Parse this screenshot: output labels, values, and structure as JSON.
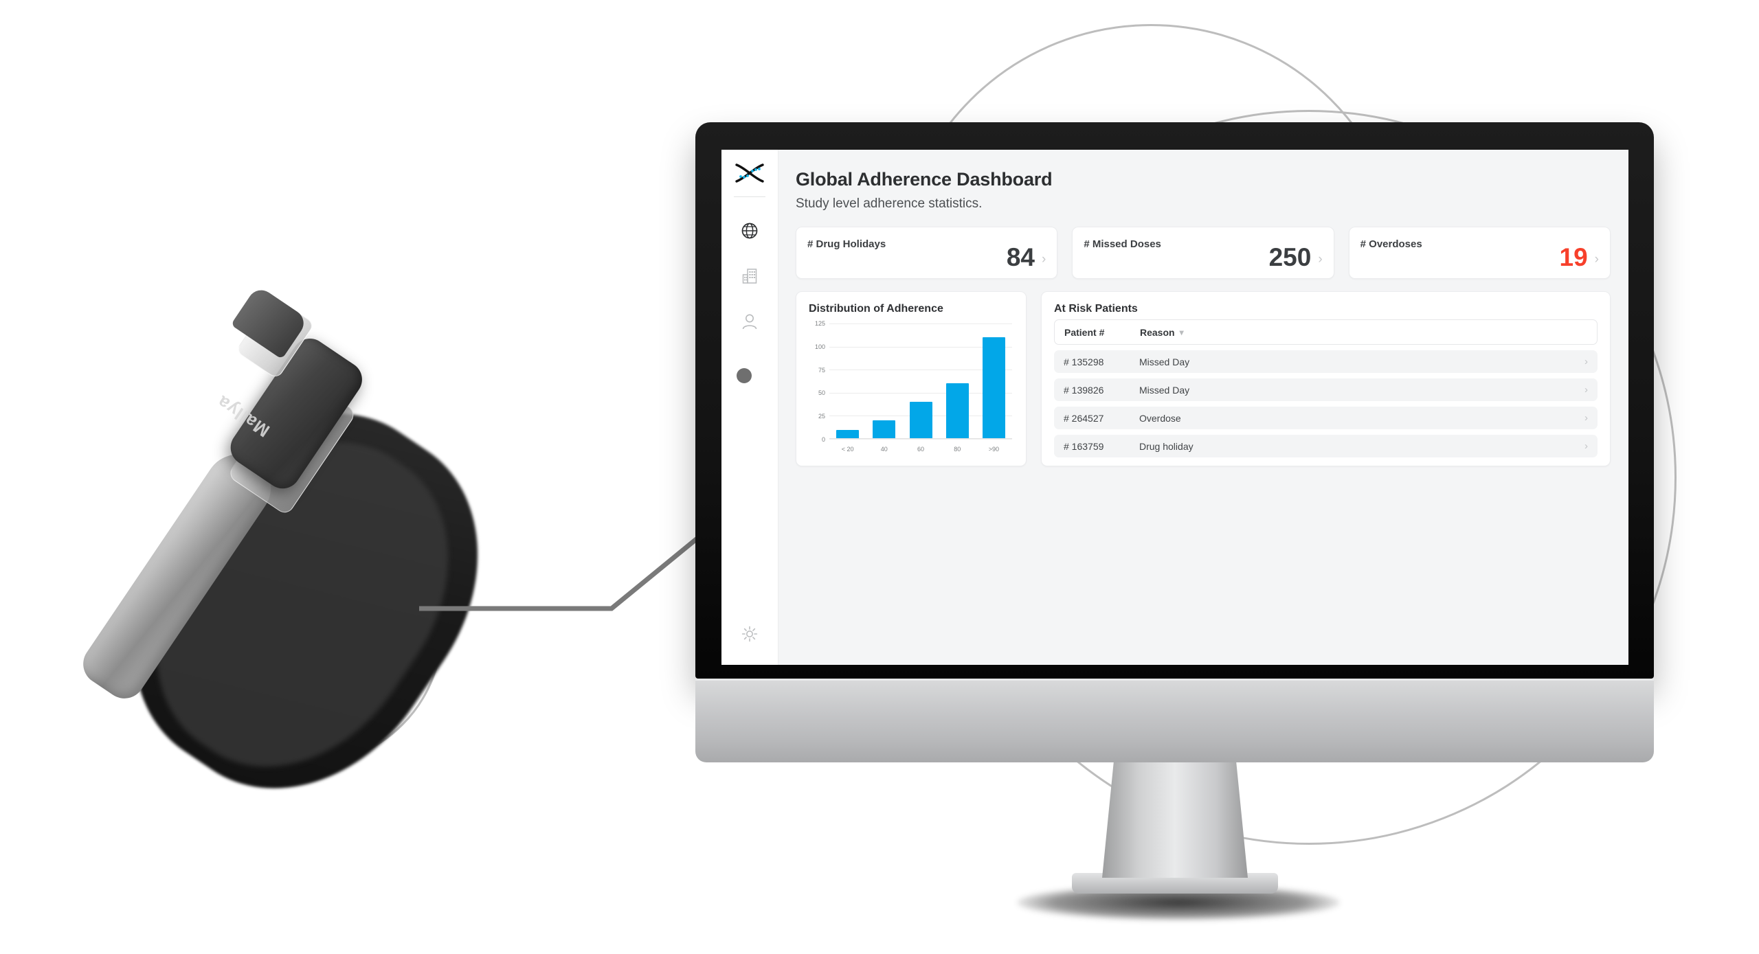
{
  "app": {
    "logo_name": "dna-helix-logo",
    "accent_blue": "#02a7e8",
    "danger_red": "#f7402b"
  },
  "sidebar": {
    "items": [
      {
        "icon": "globe-icon",
        "name": "sidebar-item-global",
        "active": true
      },
      {
        "icon": "building-icon",
        "name": "sidebar-item-sites",
        "active": false
      },
      {
        "icon": "person-icon",
        "name": "sidebar-item-patients",
        "active": false
      }
    ],
    "bottom": {
      "icon": "gear-icon",
      "name": "sidebar-item-settings"
    }
  },
  "header": {
    "title": "Global Adherence Dashboard",
    "subtitle": "Study level adherence statistics."
  },
  "stats": [
    {
      "label": "# Drug Holidays",
      "value": "84",
      "danger": false,
      "chevron": "›"
    },
    {
      "label": "# Missed Doses",
      "value": "250",
      "danger": false,
      "chevron": "›"
    },
    {
      "label": "# Overdoses",
      "value": "19",
      "danger": true,
      "chevron": "›"
    }
  ],
  "chart_panel": {
    "title": "Distribution of Adherence"
  },
  "chart_data": {
    "type": "bar",
    "title": "Distribution of Adherence",
    "categories": [
      "< 20",
      "40",
      "60",
      "80",
      ">90"
    ],
    "values": [
      10,
      20,
      40,
      60,
      110
    ],
    "yticks": [
      0,
      25,
      50,
      75,
      100,
      125
    ],
    "ylim": [
      0,
      125
    ],
    "xlabel": "",
    "ylabel": "",
    "grid": true,
    "legend": false,
    "series_color": "#02a7e8"
  },
  "risk_panel": {
    "title": "At Risk Patients",
    "columns": [
      "Patient #",
      "Reason"
    ],
    "sort_icon": "chevron-down-icon",
    "rows": [
      {
        "patient": "# 135298",
        "reason": "Missed Day",
        "chevron": "›"
      },
      {
        "patient": "# 139826",
        "reason": "Missed Day",
        "chevron": "›"
      },
      {
        "patient": "# 264527",
        "reason": "Overdose",
        "chevron": "›"
      },
      {
        "patient": "# 163759",
        "reason": "Drug holiday",
        "chevron": "›"
      }
    ]
  },
  "device": {
    "brand": "Mallya"
  }
}
